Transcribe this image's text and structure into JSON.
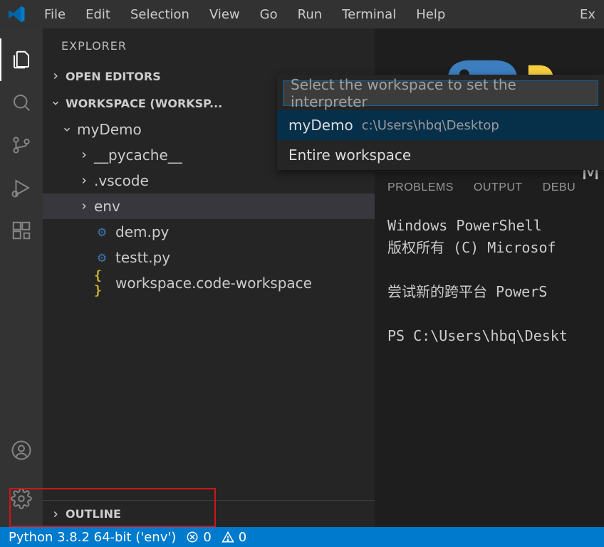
{
  "menu": {
    "file": "File",
    "edit": "Edit",
    "selection": "Selection",
    "view": "View",
    "go": "Go",
    "run": "Run",
    "terminal": "Terminal",
    "help": "Help",
    "right": "Ex"
  },
  "sidebar": {
    "title": "EXPLORER",
    "sections": {
      "open_editors": "OPEN EDITORS",
      "workspace": "WORKSPACE (WORKSP...",
      "outline": "OUTLINE"
    },
    "tree": {
      "root": "myDemo",
      "items": [
        {
          "label": "__pycache__",
          "kind": "folder"
        },
        {
          "label": ".vscode",
          "kind": "folder"
        },
        {
          "label": "env",
          "kind": "folder",
          "selected": true
        },
        {
          "label": "dem.py",
          "kind": "python"
        },
        {
          "label": "testt.py",
          "kind": "python"
        },
        {
          "label": "workspace.code-workspace",
          "kind": "json"
        }
      ]
    }
  },
  "quick_pick": {
    "placeholder": "Select the workspace to set the interpreter",
    "items": [
      {
        "title": "myDemo",
        "detail": "c:\\Users\\hbq\\Desktop",
        "selected": true
      },
      {
        "title": "Entire workspace",
        "detail": ""
      }
    ]
  },
  "panel": {
    "tabs": {
      "problems": "PROBLEMS",
      "output": "OUTPUT",
      "debug": "DEBU"
    },
    "terminal_lines": [
      "Windows PowerShell",
      "版权所有 (C) Microsof",
      "",
      "尝试新的跨平台 PowerS",
      "",
      "PS C:\\Users\\hbq\\Deskt"
    ]
  },
  "status": {
    "python": "Python 3.8.2 64-bit ('env')",
    "errors": "0",
    "warnings": "0"
  },
  "editor": {
    "caption": "M"
  }
}
